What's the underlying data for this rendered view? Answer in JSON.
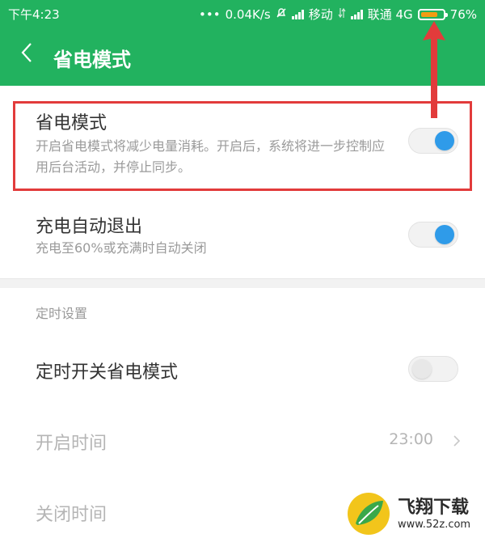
{
  "status_bar": {
    "time": "下午4:23",
    "dots": "•••",
    "speed": "0.04K/s",
    "carrier1": "移动",
    "carrier2": "联通 4G",
    "battery_level": 0.76,
    "battery_text": "76%"
  },
  "action_bar": {
    "back_icon": "chevron-left-icon",
    "title": "省电模式"
  },
  "settings": {
    "power_saving": {
      "title": "省电模式",
      "desc": "开启省电模式将减少电量消耗。开启后，系统将进一步控制应用后台活动，并停止同步。",
      "enabled": true
    },
    "auto_exit_charging": {
      "title": "充电自动退出",
      "desc": "充电至60%或充满时自动关闭",
      "enabled": true
    }
  },
  "schedule": {
    "header": "定时设置",
    "toggle": {
      "title": "定时开关省电模式",
      "enabled": false
    },
    "start": {
      "label": "开启时间",
      "value": "23:00"
    },
    "end": {
      "label": "关闭时间"
    }
  },
  "watermark": {
    "brand": "飞翔下载",
    "url": "www.52z.com"
  },
  "colors": {
    "accent": "#22b25f",
    "toggle_on": "#2f9be9",
    "highlight_border": "#e23b3b",
    "battery": "#f39c12"
  }
}
